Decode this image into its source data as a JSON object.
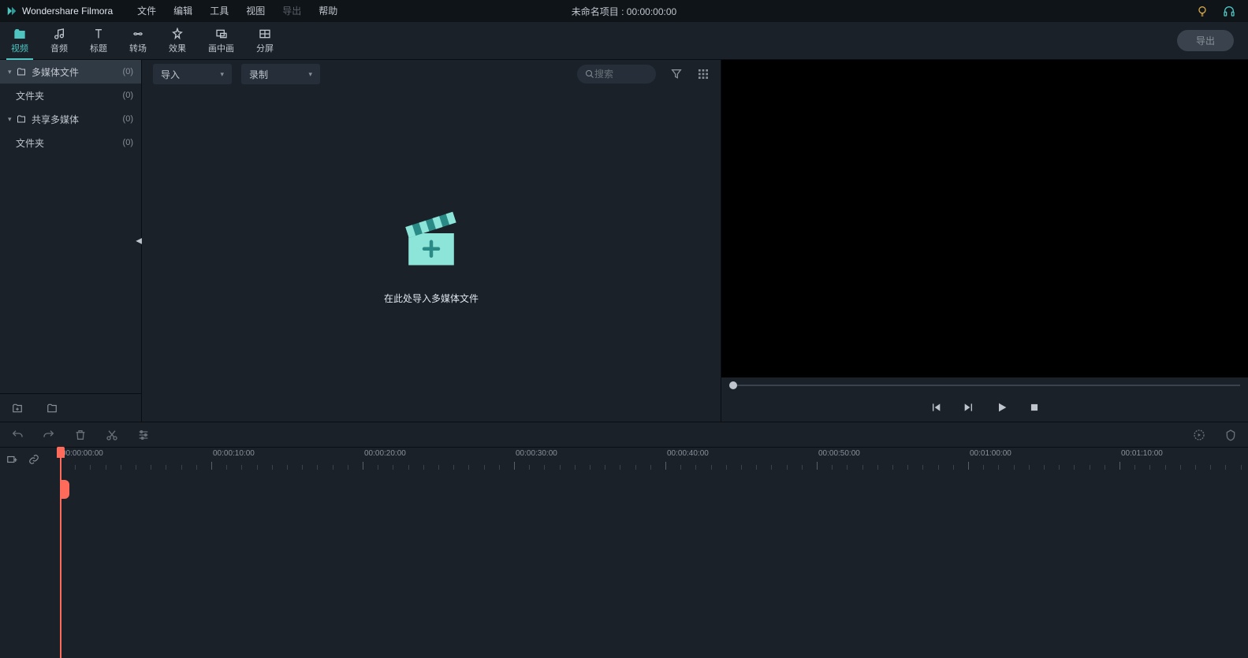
{
  "titlebar": {
    "app_name": "Wondershare Filmora",
    "menu": [
      "文件",
      "编辑",
      "工具",
      "视图",
      "导出",
      "帮助"
    ],
    "menu_disabled_index": 4,
    "project_title": "未命名项目 : 00:00:00:00"
  },
  "tabs": [
    {
      "label": "视频",
      "icon": "folder"
    },
    {
      "label": "音频",
      "icon": "music"
    },
    {
      "label": "标题",
      "icon": "text"
    },
    {
      "label": "转场",
      "icon": "transition"
    },
    {
      "label": "效果",
      "icon": "effects"
    },
    {
      "label": "画中画",
      "icon": "pip"
    },
    {
      "label": "分屏",
      "icon": "split"
    }
  ],
  "active_tab": 0,
  "export_label": "导出",
  "sidebar": {
    "items": [
      {
        "name": "多媒体文件",
        "count": "(0)",
        "folder": true,
        "expandable": true,
        "selected": true
      },
      {
        "name": "文件夹",
        "count": "(0)",
        "folder": false,
        "child": true
      },
      {
        "name": "共享多媒体",
        "count": "(0)",
        "folder": true,
        "expandable": true
      },
      {
        "name": "文件夹",
        "count": "(0)",
        "folder": false,
        "child": true
      }
    ]
  },
  "media_toolbar": {
    "import_label": "导入",
    "record_label": "录制",
    "search_placeholder": "搜索"
  },
  "import_hint": "在此处导入多媒体文件",
  "timeline": {
    "ticks": [
      "00:00:00:00",
      "00:00:10:00",
      "00:00:20:00",
      "00:00:30:00",
      "00:00:40:00",
      "00:00:50:00",
      "00:01:00:00",
      "00:01:10:00"
    ]
  },
  "colors": {
    "accent": "#4ec5c1",
    "playhead": "#ff6b5b",
    "bg": "#1a2129"
  }
}
